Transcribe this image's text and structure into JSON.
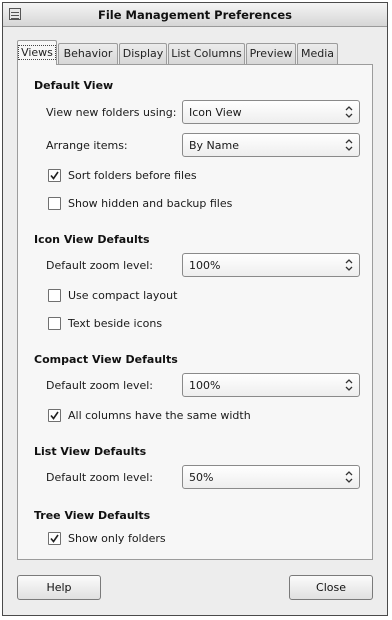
{
  "window": {
    "title": "File Management Preferences"
  },
  "tabs": [
    {
      "label": "Views"
    },
    {
      "label": "Behavior"
    },
    {
      "label": "Display"
    },
    {
      "label": "List Columns"
    },
    {
      "label": "Preview"
    },
    {
      "label": "Media"
    }
  ],
  "active_tab": "Views",
  "default_view": {
    "title": "Default View",
    "view_new_folders_label": "View new folders using:",
    "view_new_folders_value": "Icon View",
    "arrange_items_label": "Arrange items:",
    "arrange_items_value": "By Name",
    "sort_folders_label": "Sort folders before files",
    "sort_folders_checked": true,
    "show_hidden_label": "Show hidden and backup files",
    "show_hidden_checked": false
  },
  "icon_view_defaults": {
    "title": "Icon View Defaults",
    "zoom_label": "Default zoom level:",
    "zoom_value": "100%",
    "compact_layout_label": "Use compact layout",
    "compact_layout_checked": false,
    "text_beside_icons_label": "Text beside icons",
    "text_beside_icons_checked": false
  },
  "compact_view_defaults": {
    "title": "Compact View Defaults",
    "zoom_label": "Default zoom level:",
    "zoom_value": "100%",
    "same_width_label": "All columns have the same width",
    "same_width_checked": true
  },
  "list_view_defaults": {
    "title": "List View Defaults",
    "zoom_label": "Default zoom level:",
    "zoom_value": "50%"
  },
  "tree_view_defaults": {
    "title": "Tree View Defaults",
    "show_only_folders_label": "Show only folders",
    "show_only_folders_checked": true
  },
  "buttons": {
    "help": "Help",
    "close": "Close"
  }
}
